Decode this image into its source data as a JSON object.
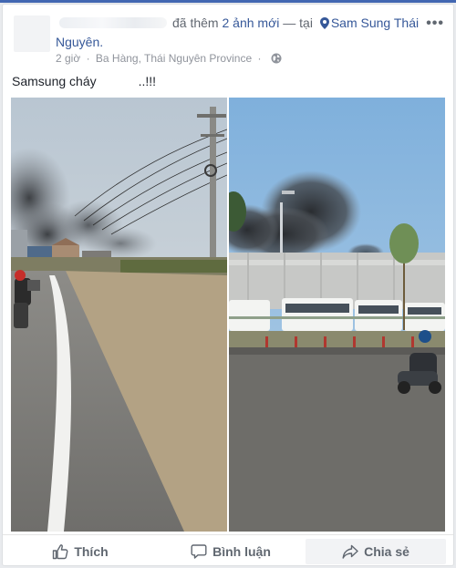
{
  "post": {
    "headline_text": "đã thêm",
    "headline_count": "2 ảnh mới",
    "headline_dash": "— tại",
    "place_first": "Sam Sung Thái",
    "place_second": "Nguyên.",
    "time": "2 giờ",
    "separator": "·",
    "location": "Ba Hàng, Thái Nguyên Province",
    "privacy_icon": "globe-icon",
    "more_icon": "ellipsis-icon",
    "text_start": "Samsung cháy",
    "text_end": "..!!!"
  },
  "actions": {
    "like": "Thích",
    "comment": "Bình luận",
    "share": "Chia sẻ"
  },
  "colors": {
    "link": "#365899",
    "muted": "#90949c",
    "action": "#606770",
    "share_bg": "#f2f3f5"
  }
}
